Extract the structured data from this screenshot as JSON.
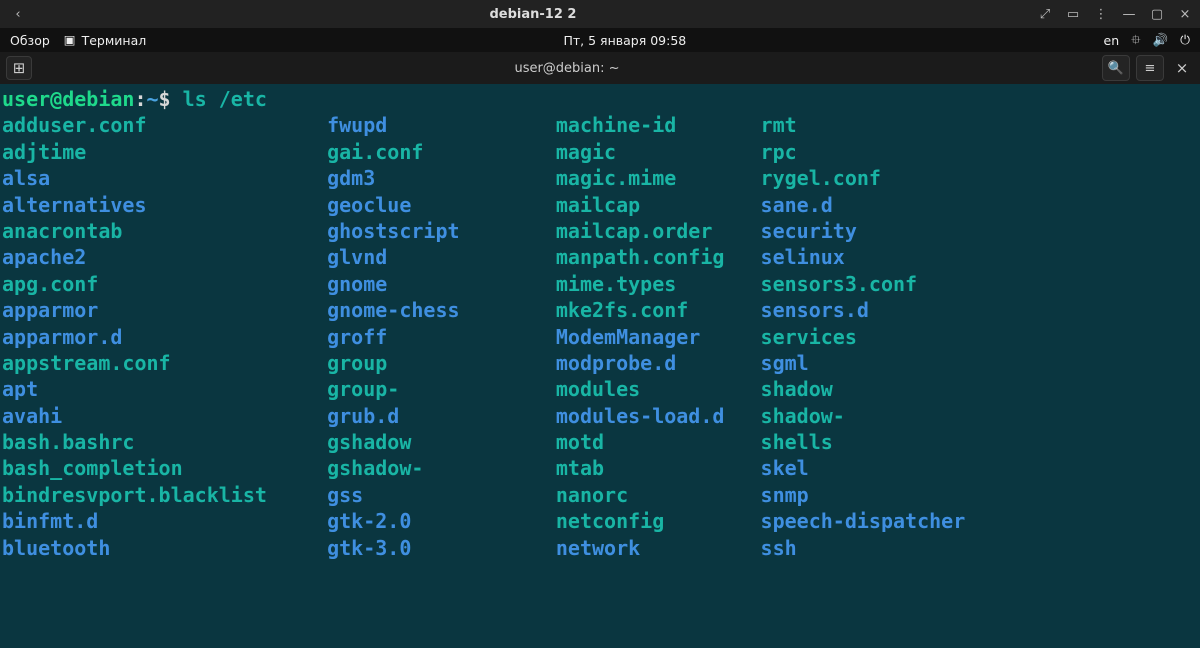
{
  "window": {
    "title": "debian-12 2",
    "back_glyph": "‹",
    "fullscreen_glyph": "⤢",
    "tray_glyph": "▭",
    "menu_glyph": "⋮",
    "min_glyph": "—",
    "max_glyph": "▢",
    "close_glyph": "×"
  },
  "gnome": {
    "activities": "Обзор",
    "terminal_app": "Терминал",
    "terminal_glyph": "▣",
    "clock": "Пт, 5 января  09:58",
    "lang": "en",
    "network_glyph": "⯐",
    "volume_glyph": "🔊",
    "power_glyph": "⏻"
  },
  "terminal_header": {
    "newtab_glyph": "⊞",
    "title": "user@debian: ~",
    "search_glyph": "🔍",
    "hamburger_glyph": "≡",
    "close_glyph": "×"
  },
  "prompt": {
    "user": "user@debian",
    "sep": ":",
    "path": "~",
    "dollar": "$",
    "command": "ls /etc"
  },
  "columns": [
    [
      {
        "name": "adduser.conf",
        "kind": "file"
      },
      {
        "name": "adjtime",
        "kind": "file"
      },
      {
        "name": "alsa",
        "kind": "dir"
      },
      {
        "name": "alternatives",
        "kind": "dir"
      },
      {
        "name": "anacrontab",
        "kind": "file"
      },
      {
        "name": "apache2",
        "kind": "dir"
      },
      {
        "name": "apg.conf",
        "kind": "file"
      },
      {
        "name": "apparmor",
        "kind": "dir"
      },
      {
        "name": "apparmor.d",
        "kind": "dir"
      },
      {
        "name": "appstream.conf",
        "kind": "file"
      },
      {
        "name": "apt",
        "kind": "dir"
      },
      {
        "name": "avahi",
        "kind": "dir"
      },
      {
        "name": "bash.bashrc",
        "kind": "file"
      },
      {
        "name": "bash_completion",
        "kind": "file"
      },
      {
        "name": "bindresvport.blacklist",
        "kind": "file"
      },
      {
        "name": "binfmt.d",
        "kind": "dir"
      },
      {
        "name": "bluetooth",
        "kind": "dir"
      }
    ],
    [
      {
        "name": "fwupd",
        "kind": "dir"
      },
      {
        "name": "gai.conf",
        "kind": "file"
      },
      {
        "name": "gdm3",
        "kind": "dir"
      },
      {
        "name": "geoclue",
        "kind": "dir"
      },
      {
        "name": "ghostscript",
        "kind": "dir"
      },
      {
        "name": "glvnd",
        "kind": "dir"
      },
      {
        "name": "gnome",
        "kind": "dir"
      },
      {
        "name": "gnome-chess",
        "kind": "dir"
      },
      {
        "name": "groff",
        "kind": "dir"
      },
      {
        "name": "group",
        "kind": "file"
      },
      {
        "name": "group-",
        "kind": "file"
      },
      {
        "name": "grub.d",
        "kind": "dir"
      },
      {
        "name": "gshadow",
        "kind": "file"
      },
      {
        "name": "gshadow-",
        "kind": "file"
      },
      {
        "name": "gss",
        "kind": "dir"
      },
      {
        "name": "gtk-2.0",
        "kind": "dir"
      },
      {
        "name": "gtk-3.0",
        "kind": "dir"
      }
    ],
    [
      {
        "name": "machine-id",
        "kind": "file"
      },
      {
        "name": "magic",
        "kind": "file"
      },
      {
        "name": "magic.mime",
        "kind": "file"
      },
      {
        "name": "mailcap",
        "kind": "file"
      },
      {
        "name": "mailcap.order",
        "kind": "file"
      },
      {
        "name": "manpath.config",
        "kind": "file"
      },
      {
        "name": "mime.types",
        "kind": "file"
      },
      {
        "name": "mke2fs.conf",
        "kind": "file"
      },
      {
        "name": "ModemManager",
        "kind": "dir"
      },
      {
        "name": "modprobe.d",
        "kind": "dir"
      },
      {
        "name": "modules",
        "kind": "file"
      },
      {
        "name": "modules-load.d",
        "kind": "dir"
      },
      {
        "name": "motd",
        "kind": "file"
      },
      {
        "name": "mtab",
        "kind": "file",
        "bold": true
      },
      {
        "name": "nanorc",
        "kind": "file"
      },
      {
        "name": "netconfig",
        "kind": "file"
      },
      {
        "name": "network",
        "kind": "dir"
      }
    ],
    [
      {
        "name": "rmt",
        "kind": "file",
        "bold": true
      },
      {
        "name": "rpc",
        "kind": "file"
      },
      {
        "name": "rygel.conf",
        "kind": "file"
      },
      {
        "name": "sane.d",
        "kind": "dir"
      },
      {
        "name": "security",
        "kind": "dir"
      },
      {
        "name": "selinux",
        "kind": "dir"
      },
      {
        "name": "sensors3.conf",
        "kind": "file"
      },
      {
        "name": "sensors.d",
        "kind": "dir"
      },
      {
        "name": "services",
        "kind": "file"
      },
      {
        "name": "sgml",
        "kind": "dir"
      },
      {
        "name": "shadow",
        "kind": "file"
      },
      {
        "name": "shadow-",
        "kind": "file"
      },
      {
        "name": "shells",
        "kind": "file"
      },
      {
        "name": "skel",
        "kind": "dir"
      },
      {
        "name": "snmp",
        "kind": "dir"
      },
      {
        "name": "speech-dispatcher",
        "kind": "dir"
      },
      {
        "name": "ssh",
        "kind": "dir"
      }
    ]
  ]
}
